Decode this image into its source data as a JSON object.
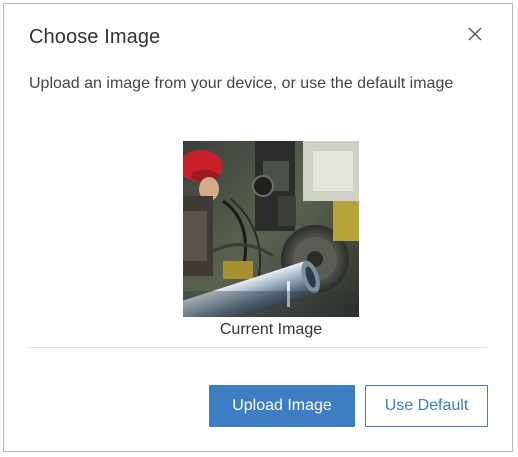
{
  "dialog": {
    "title": "Choose Image",
    "close_icon": "close-icon",
    "description": "Upload an image from your device, or use the default image",
    "image": {
      "icon": "current-image-photo",
      "caption": "Current Image"
    },
    "buttons": {
      "upload_label": "Upload Image",
      "default_label": "Use Default"
    },
    "colors": {
      "accent": "#3c7dc4",
      "border": "#b8b8b8",
      "divider": "#e2e2e2"
    }
  }
}
